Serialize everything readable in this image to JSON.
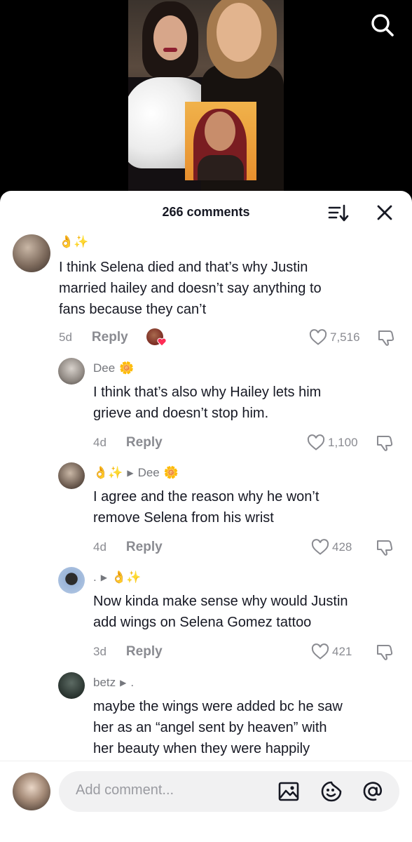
{
  "header": {
    "comment_count": "266 comments",
    "sort_icon": "sort-icon",
    "close_icon": "close-icon"
  },
  "video": {
    "search_icon": "search-icon"
  },
  "comments": [
    {
      "name_emoji": "👌✨",
      "text_lines": [
        "I think Selena died and that’s why Justin",
        "married hailey and doesn’t say anything to",
        "fans because they can’t"
      ],
      "date": "5d",
      "reply": "Reply",
      "likes": "7,516"
    },
    {
      "name": "Dee",
      "name_emoji": "🌼",
      "text_lines": [
        "I think that’s also why Hailey lets him",
        "grieve and doesn’t stop him."
      ],
      "date": "4d",
      "reply": "Reply",
      "likes": "1,100"
    },
    {
      "name_emoji": "👌✨",
      "reply_to": "Dee",
      "reply_to_emoji": "🌼",
      "text_lines": [
        "I agree and the reason why he won’t",
        "remove Selena from his wrist"
      ],
      "date": "4d",
      "reply": "Reply",
      "likes": "428"
    },
    {
      "name": ".",
      "reply_to_emoji": "👌✨",
      "text_lines": [
        "Now kinda make sense why would Justin",
        "add wings on Selena Gomez tattoo"
      ],
      "date": "3d",
      "reply": "Reply",
      "likes": "421"
    },
    {
      "name": "betz",
      "reply_to": ".",
      "text_lines": [
        "maybe the wings were added bc he saw",
        "her as an “angel sent by heaven” with",
        "her beauty when they were happily"
      ]
    }
  ],
  "composer": {
    "placeholder": "Add comment...",
    "icons": [
      "image-icon",
      "emoji-icon",
      "mention-icon"
    ]
  },
  "colors": {
    "accent_red": "#fe2c55",
    "text_primary": "#161823",
    "text_secondary": "#8a8b91"
  }
}
